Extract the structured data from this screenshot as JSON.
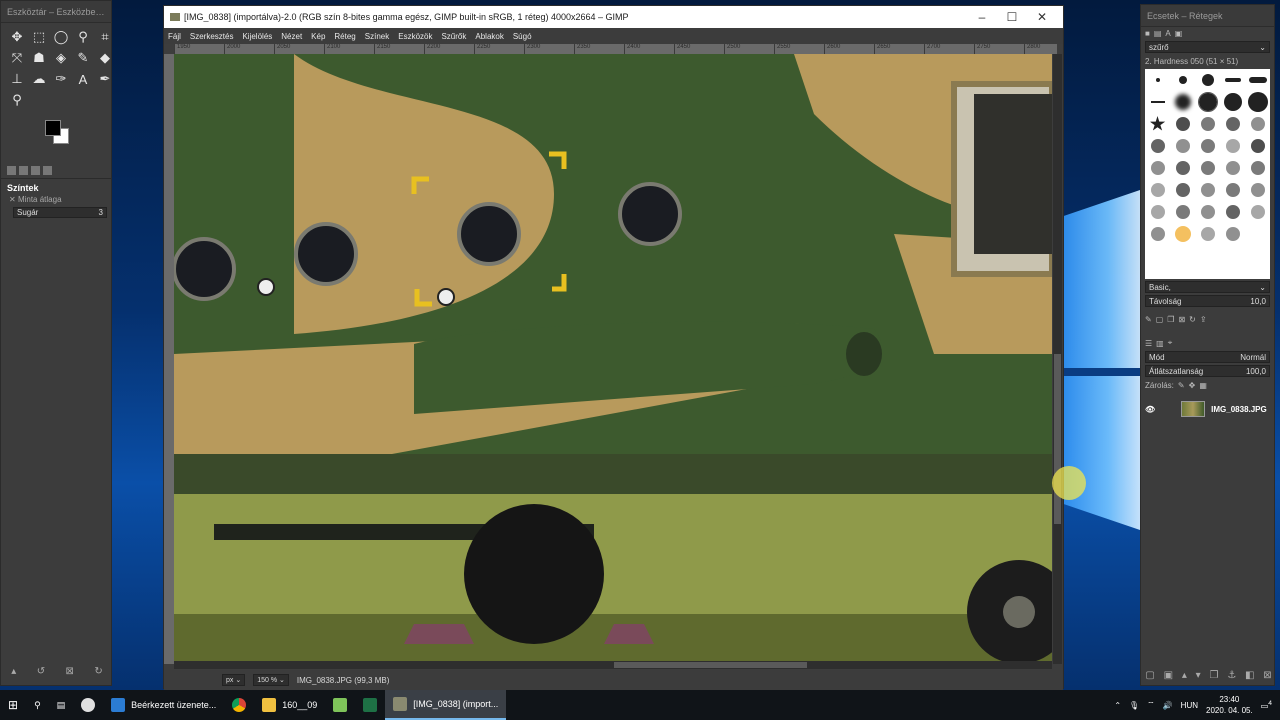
{
  "toolbox": {
    "title": "Eszköztár – Eszközbeálli...",
    "section_title": "Színtek",
    "option_label": "Minta átlaga",
    "radius_label": "Sugár",
    "radius_value": "3"
  },
  "main": {
    "title": "[IMG_0838] (importálva)-2.0 (RGB szín 8-bites gamma egész, GIMP built-in sRGB, 1 réteg) 4000x2664 – GIMP",
    "menu": [
      "Fájl",
      "Szerkesztés",
      "Kijelölés",
      "Nézet",
      "Kép",
      "Réteg",
      "Színek",
      "Eszközök",
      "Szűrők",
      "Ablakok",
      "Súgó"
    ],
    "ruler_ticks": [
      "1950",
      "2000",
      "2050",
      "2100",
      "2150",
      "2200",
      "2250",
      "2300",
      "2350",
      "2400",
      "2450",
      "2500",
      "2550",
      "2600",
      "2650",
      "2700",
      "2750",
      "2800",
      "2850"
    ],
    "status_unit": "px",
    "status_zoom": "150 %",
    "status_file": "IMG_0838.JPG (99,3 MB)"
  },
  "rightdock": {
    "title": "Ecsetek – Rétegek",
    "filter_placeholder": "szűrő",
    "brush_name": "2. Hardness 050 (51 × 51)",
    "brush_preset": "Basic,",
    "spacing_label": "Távolság",
    "spacing_value": "10,0",
    "mode_label": "Mód",
    "mode_value": "Normál",
    "opacity_label": "Átlátszatlanság",
    "opacity_value": "100,0",
    "lock_label": "Zárolás:",
    "layer_name": "IMG_0838.JPG"
  },
  "taskbar": {
    "items": [
      "Beérkezett üzenete...",
      "160__09",
      "[IMG_0838] (import..."
    ],
    "lang": "HUN",
    "time": "23:40",
    "date": "2020. 04. 05.",
    "notif_count": "4"
  }
}
